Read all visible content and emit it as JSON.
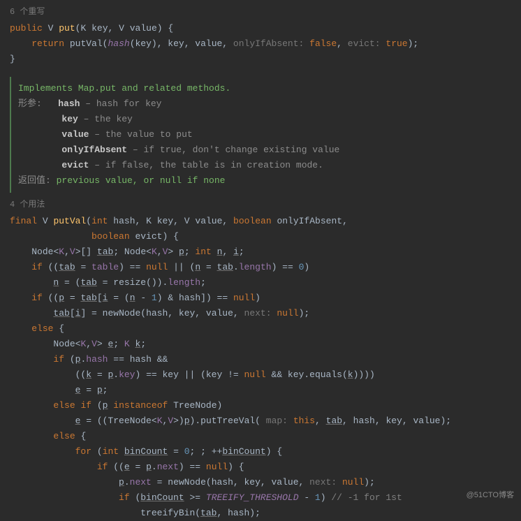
{
  "usages_top": "6 个重写",
  "put_method": {
    "sig_public": "public",
    "ret_type": "V",
    "name": "put",
    "param_k": "K",
    "param_key": "key",
    "param_v": "V",
    "param_value": "value",
    "return_kw": "return",
    "call": "putVal",
    "hash_fn": "hash",
    "hint1": "onlyIfAbsent:",
    "false_kw": "false",
    "hint2": "evict:",
    "true_kw": "true"
  },
  "doc": {
    "summary": "Implements Map.put and related methods.",
    "params_label": "形参:",
    "p1_name": "hash",
    "p1_desc": "– hash for key",
    "p2_name": "key",
    "p2_desc": "– the key",
    "p3_name": "value",
    "p3_desc": "– the value to put",
    "p4_name": "onlyIfAbsent",
    "p4_desc": "– if true, don't change existing value",
    "p5_name": "evict",
    "p5_desc": "– if false, the table is in creation mode.",
    "returns_label": "返回值:",
    "returns_desc": "previous value, or null if none"
  },
  "usages_mid": "4 个用法",
  "putval": {
    "final": "final",
    "ret": "V",
    "name": "putVal",
    "int": "int",
    "hash": "hash",
    "K": "K",
    "key": "key",
    "V": "V",
    "value": "value",
    "boolean": "boolean",
    "onlyIfAbsent": "onlyIfAbsent",
    "evict": "evict"
  },
  "body": {
    "node": "Node",
    "tab": "tab",
    "p": "p",
    "n": "n",
    "i": "i",
    "if": "if",
    "table": "table",
    "null": "null",
    "length": "length",
    "resize": "resize",
    "newNode": "newNode",
    "nextHint": "next:",
    "else": "else",
    "e": "e",
    "k": "k",
    "hashField": "hash",
    "keyField": "key",
    "equals": "equals",
    "instanceof": "instanceof",
    "TreeNode": "TreeNode",
    "putTreeVal": "putTreeVal",
    "mapHint": "map:",
    "this": "this",
    "for": "for",
    "binCount": "binCount",
    "zero": "0",
    "one": "1",
    "next": "next",
    "TREEIFY": "TREEIFY_THRESHOLD",
    "comment1st": "// -1 for 1st",
    "treeifyBin": "treeifyBin"
  },
  "watermark": "@51CTO博客"
}
